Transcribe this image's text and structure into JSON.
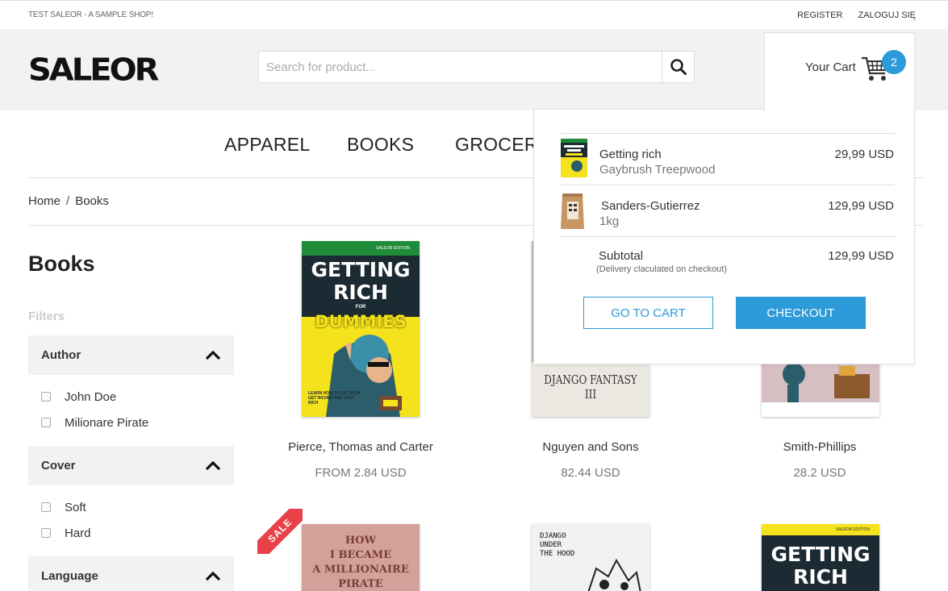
{
  "topbar": {
    "tagline": "TEST SALEOR - A SAMPLE SHOP!",
    "register": "REGISTER",
    "login": "ZALOGUJ SIĘ"
  },
  "header": {
    "logo": "SALEOR",
    "search_placeholder": "Search for product...",
    "cart_label": "Your Cart",
    "cart_count": "2"
  },
  "nav": {
    "items": [
      "APPAREL",
      "BOOKS",
      "GROCER"
    ]
  },
  "breadcrumb": {
    "home": "Home",
    "separator": "/",
    "current": "Books"
  },
  "sidebar": {
    "title": "Books",
    "filters_label": "Filters",
    "groups": [
      {
        "name": "Author",
        "options": [
          "John Doe",
          "Milionare Pirate"
        ]
      },
      {
        "name": "Cover",
        "options": [
          "Soft",
          "Hard"
        ]
      },
      {
        "name": "Language",
        "options": []
      }
    ]
  },
  "products": [
    {
      "name": "Pierce, Thomas and Carter",
      "price": "FROM 2.84 USD"
    },
    {
      "name": "Nguyen and Sons",
      "price": "82.44 USD"
    },
    {
      "name": "Smith-Phillips",
      "price": "28.2 USD"
    }
  ],
  "covers": {
    "getting_rich": {
      "edition": "SALEOR EDITION",
      "line1": "GETTING",
      "line2": "RICH",
      "for": "FOR",
      "line3": "DUMMIES",
      "tagline": "LEARN HOW TO GET RICH, GET RICHER AND STAY RICH"
    },
    "django": {
      "title": "DJANGO FANTASY III"
    },
    "how": {
      "line1": "HOW",
      "line2": "I BECAME",
      "line3": "A MILLIONAIRE",
      "line4": "PIRATE"
    },
    "django_hood": {
      "line1": "DJANGO",
      "line2": "UNDER",
      "line3": "THE HOOD"
    },
    "sale": "SALE"
  },
  "cart_dropdown": {
    "items": [
      {
        "name": "Getting rich",
        "variant": "Gaybrush Treepwood",
        "price": "29,99 USD"
      },
      {
        "name": "Sanders-Gutierrez",
        "variant": "1kg",
        "price": "129,99 USD"
      }
    ],
    "subtotal_label": "Subtotal",
    "subtotal_note": "(Delivery claculated on checkout)",
    "subtotal_value": "129,99 USD",
    "go_to_cart": "GO TO CART",
    "checkout": "CHECKOUT"
  },
  "colors": {
    "accent": "#2d9ad9",
    "sale": "#e8414a",
    "header_bg": "#f2f2f2"
  }
}
